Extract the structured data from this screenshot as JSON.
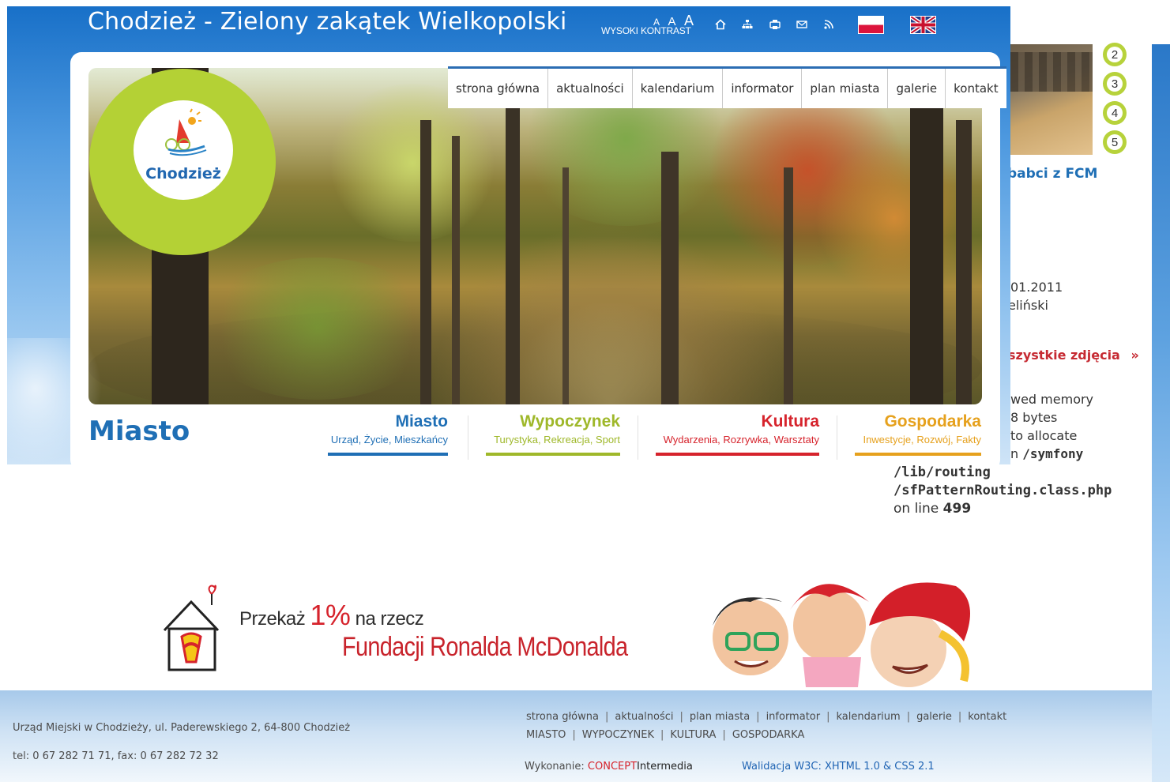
{
  "header": {
    "site_title": "Chodzież - Zielony zakątek Wielkopolski",
    "contrast_label": "WYSOKI KONTRAST",
    "font_sizes": [
      "A",
      "A",
      "A"
    ],
    "icons": [
      "home-icon",
      "sitemap-icon",
      "print-icon",
      "mail-icon",
      "rss-icon"
    ],
    "flags": [
      "flag-pl",
      "flag-uk"
    ]
  },
  "logo": {
    "text": "Chodzież"
  },
  "nav": {
    "items": [
      "strona główna",
      "aktualności",
      "kalendarium",
      "informator",
      "plan miasta",
      "galerie",
      "kontakt"
    ]
  },
  "section": {
    "title": "Miasto",
    "categories": [
      {
        "title": "Miasto",
        "subtitle": "Urząd, Życie, Mieszkańcy",
        "color": "#1f6fb5"
      },
      {
        "title": "Wypoczynek",
        "subtitle": "Turystyka, Rekreacja, Sport",
        "color": "#9fb82a"
      },
      {
        "title": "Kultura",
        "subtitle": "Wydarzenia, Rozrywka, Warsztaty",
        "color": "#d6232c"
      },
      {
        "title": "Gospodarka",
        "subtitle": "Inwestycje, Rozwój, Fakty",
        "color": "#e6a11d"
      }
    ]
  },
  "side_panel": {
    "pager": [
      "2",
      "3",
      "4",
      "5"
    ],
    "headline": "babci z FCM",
    "date": "01.2011",
    "author": "eliński",
    "all_photos": "szystkie zdjęcia",
    "all_photos_arrow": "»"
  },
  "error": {
    "line1": "wed memory",
    "line2": "8 bytes",
    "line3": "to allocate",
    "line4_prefix": "n",
    "line4_path": "/symfony",
    "line5": "/lib/routing",
    "line6": "/sfPatternRouting.class.php",
    "line7_prefix": "on line",
    "line7_num": "499"
  },
  "banner": {
    "przekaz": "Przekaż",
    "one": "1",
    "percent": "%",
    "na_rzecz": "na rzecz",
    "fundacji": "Fundacji Ronalda McDonalda"
  },
  "footer": {
    "address": "Urząd Miejski w Chodzieży, ul. Paderewskiego 2, 64-800 Chodzież",
    "phone": "tel: 0 67 282 71 71, fax: 0 67 282 72 32",
    "links_row1": [
      "strona główna",
      "aktualności",
      "plan miasta",
      "informator",
      "kalendarium",
      "galerie",
      "kontakt"
    ],
    "links_row2": [
      "MIASTO",
      "WYPOCZYNEK",
      "KULTURA",
      "GOSPODARKA"
    ],
    "credit_label": "Wykonanie:",
    "credit_concept": "CONCEPT",
    "credit_intermedia": "Intermedia",
    "validation": "Walidacja W3C: XHTML 1.0 & CSS 2.1"
  }
}
